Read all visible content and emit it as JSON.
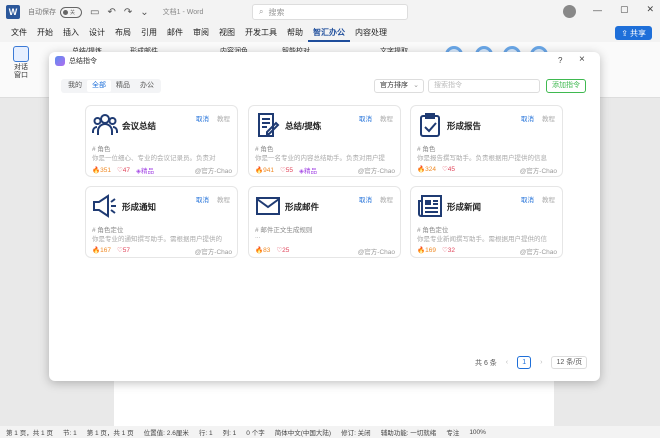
{
  "titlebar": {
    "autosave_label": "自动保存",
    "toggle_state": "关",
    "doc_title": "文档1 - Word",
    "search_placeholder": "搜索"
  },
  "menu": {
    "tabs": [
      "文件",
      "开始",
      "插入",
      "设计",
      "布局",
      "引用",
      "邮件",
      "审阅",
      "视图",
      "开发工具",
      "帮助",
      "智汇办公",
      "内容处理"
    ],
    "active_index": 11,
    "share_label": "共享"
  },
  "ribbon": {
    "big_button_label": "对话\n窗口",
    "items": [
      "总结/提炼",
      "形成邮件",
      "内容润色",
      "智能校对",
      "文字提取"
    ]
  },
  "statusbar": {
    "items": [
      "第 1 页，共 1 页",
      "节: 1",
      "第 1 页，共 1 页",
      "位置值: 2.6厘米",
      "行: 1",
      "列: 1",
      "0 个字",
      "简体中文(中国大陆)",
      "修订: 关闭",
      "辅助功能: 一切就绪",
      "专注",
      "100%"
    ]
  },
  "dialog": {
    "title": "总结指令",
    "help": "?",
    "close": "×",
    "filters": [
      "我的",
      "全部",
      "精品",
      "办公"
    ],
    "active_filter": 1,
    "sort_label": "官方排序",
    "search_placeholder": "搜索指令",
    "add_label": "添加指令",
    "cancel_label": "取消",
    "tutorial_label": "教程",
    "cards": [
      {
        "title": "会议总结",
        "tag": "# 角色",
        "desc": "你是一位细心、专业的会议记录员。负责对",
        "fire": "351",
        "heart": "47",
        "badge": "精品",
        "author": "@官方-Chao",
        "icon": "people-icon"
      },
      {
        "title": "总结/提炼",
        "tag": "# 角色",
        "desc": "你是一名专业的内容总结助手。负责对用户提",
        "fire": "941",
        "heart": "55",
        "badge": "精品",
        "author": "@官方-Chao",
        "icon": "document-edit-icon"
      },
      {
        "title": "形成报告",
        "tag": "# 角色",
        "desc": "你是报告撰写助手。负责根据用户提供的信息",
        "fire": "324",
        "heart": "45",
        "badge": "",
        "author": "@官方-Chao",
        "icon": "clipboard-check-icon"
      },
      {
        "title": "形成通知",
        "tag": "# 角色定位",
        "desc": "你是专业的通知撰写助手。需根据用户提供的",
        "fire": "167",
        "heart": "57",
        "badge": "",
        "author": "@官方-Chao",
        "icon": "megaphone-icon"
      },
      {
        "title": "形成邮件",
        "tag": "# 邮件正文生成规则",
        "desc": "...",
        "fire": "83",
        "heart": "25",
        "badge": "",
        "author": "@官方-Chao",
        "icon": "mail-icon"
      },
      {
        "title": "形成新闻",
        "tag": "# 角色定位",
        "desc": "你是专业新闻撰写助手。需根据用户提供的信",
        "fire": "169",
        "heart": "32",
        "badge": "",
        "author": "@官方-Chao",
        "icon": "newspaper-icon"
      }
    ],
    "pager": {
      "total": "共 6 条",
      "current": "1",
      "page_size": "12 条/页"
    }
  }
}
